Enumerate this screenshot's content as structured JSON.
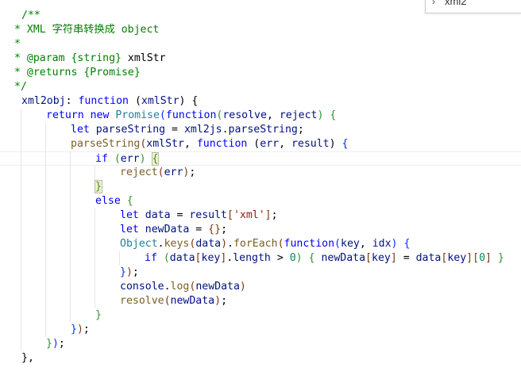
{
  "peek": {
    "label": "xml2",
    "icon": "chevron-right-icon"
  },
  "colors": {
    "comment": "#008000",
    "keyword": "#0000ff",
    "identifier": "#001080",
    "function": "#795e26",
    "type": "#267f99",
    "string": "#a31515",
    "number": "#098658",
    "bracket_level1": "#0431fa",
    "bracket_level2": "#319331",
    "bracket_level3": "#7b3814",
    "plain": "#000000",
    "indent_guide": "#e6e6e6",
    "bracket_match_bg": "#f2f2c6"
  },
  "code": {
    "current_line": 10,
    "lines": [
      {
        "indent": 1,
        "tokens": [
          {
            "t": "/**",
            "c": "comment"
          }
        ]
      },
      {
        "indent": 0,
        "tokens": [
          {
            "t": "* XML 字符串转换成 object",
            "c": "comment"
          }
        ]
      },
      {
        "indent": 0,
        "tokens": [
          {
            "t": "*",
            "c": "comment"
          }
        ]
      },
      {
        "indent": 0,
        "tokens": [
          {
            "t": "* @param {string} ",
            "c": "comment"
          },
          {
            "t": "xmlStr",
            "c": "plain"
          }
        ]
      },
      {
        "indent": 0,
        "tokens": [
          {
            "t": "* @returns {Promise}",
            "c": "comment"
          }
        ]
      },
      {
        "indent": 0,
        "tokens": [
          {
            "t": "*/",
            "c": "comment"
          }
        ]
      },
      {
        "indent": 1,
        "tokens": [
          {
            "t": "xml2obj",
            "c": "identifier"
          },
          {
            "t": ": ",
            "c": "plain"
          },
          {
            "t": "function",
            "c": "keyword"
          },
          {
            "t": " (",
            "c": "plain"
          },
          {
            "t": "xmlStr",
            "c": "identifier"
          },
          {
            "t": ") ",
            "c": "plain"
          },
          {
            "t": "{",
            "c": "plain"
          }
        ]
      },
      {
        "indent": 2,
        "tokens": [
          {
            "t": "return ",
            "c": "keyword"
          },
          {
            "t": "new ",
            "c": "keyword"
          },
          {
            "t": "Promise",
            "c": "type"
          },
          {
            "t": "(",
            "c": "bracket_level1"
          },
          {
            "t": "function",
            "c": "keyword"
          },
          {
            "t": "(",
            "c": "bracket_level2"
          },
          {
            "t": "resolve",
            "c": "identifier"
          },
          {
            "t": ", ",
            "c": "plain"
          },
          {
            "t": "reject",
            "c": "identifier"
          },
          {
            "t": ")",
            "c": "bracket_level2"
          },
          {
            "t": " ",
            "c": "plain"
          },
          {
            "t": "{",
            "c": "bracket_level2"
          }
        ]
      },
      {
        "indent": 3,
        "tokens": [
          {
            "t": "let ",
            "c": "keyword"
          },
          {
            "t": "parseString",
            "c": "identifier"
          },
          {
            "t": " = ",
            "c": "plain"
          },
          {
            "t": "xml2js",
            "c": "identifier"
          },
          {
            "t": ".",
            "c": "plain"
          },
          {
            "t": "parseString",
            "c": "identifier"
          },
          {
            "t": ";",
            "c": "plain"
          }
        ]
      },
      {
        "indent": 3,
        "tokens": [
          {
            "t": "parseString",
            "c": "function"
          },
          {
            "t": "(",
            "c": "bracket_level3"
          },
          {
            "t": "xmlStr",
            "c": "identifier"
          },
          {
            "t": ", ",
            "c": "plain"
          },
          {
            "t": "function",
            "c": "keyword"
          },
          {
            "t": " (",
            "c": "plain"
          },
          {
            "t": "err",
            "c": "identifier"
          },
          {
            "t": ", ",
            "c": "plain"
          },
          {
            "t": "result",
            "c": "identifier"
          },
          {
            "t": ") ",
            "c": "plain"
          },
          {
            "t": "{",
            "c": "bracket_level1"
          }
        ]
      },
      {
        "indent": 4,
        "tokens": [
          {
            "t": "if ",
            "c": "keyword"
          },
          {
            "t": "(",
            "c": "bracket_level2"
          },
          {
            "t": "err",
            "c": "identifier"
          },
          {
            "t": ")",
            "c": "bracket_level2"
          },
          {
            "t": " ",
            "c": "plain"
          },
          {
            "t": "{",
            "c": "bracket_level2",
            "match": true
          }
        ]
      },
      {
        "indent": 5,
        "tokens": [
          {
            "t": "reject",
            "c": "function"
          },
          {
            "t": "(",
            "c": "bracket_level3"
          },
          {
            "t": "err",
            "c": "identifier"
          },
          {
            "t": ")",
            "c": "bracket_level3"
          },
          {
            "t": ";",
            "c": "plain"
          }
        ]
      },
      {
        "indent": 4,
        "tokens": [
          {
            "t": "}",
            "c": "bracket_level2",
            "match": true
          }
        ]
      },
      {
        "indent": 4,
        "tokens": [
          {
            "t": "else ",
            "c": "keyword"
          },
          {
            "t": "{",
            "c": "bracket_level2"
          }
        ]
      },
      {
        "indent": 5,
        "tokens": [
          {
            "t": "let ",
            "c": "keyword"
          },
          {
            "t": "data",
            "c": "identifier"
          },
          {
            "t": " = ",
            "c": "plain"
          },
          {
            "t": "result",
            "c": "identifier"
          },
          {
            "t": "[",
            "c": "bracket_level3"
          },
          {
            "t": "'xml'",
            "c": "string"
          },
          {
            "t": "]",
            "c": "bracket_level3"
          },
          {
            "t": ";",
            "c": "plain"
          }
        ]
      },
      {
        "indent": 5,
        "tokens": [
          {
            "t": "let ",
            "c": "keyword"
          },
          {
            "t": "newData",
            "c": "identifier"
          },
          {
            "t": " = ",
            "c": "plain"
          },
          {
            "t": "{}",
            "c": "bracket_level3"
          },
          {
            "t": ";",
            "c": "plain"
          }
        ]
      },
      {
        "indent": 5,
        "tokens": [
          {
            "t": "Object",
            "c": "type"
          },
          {
            "t": ".",
            "c": "plain"
          },
          {
            "t": "keys",
            "c": "function"
          },
          {
            "t": "(",
            "c": "bracket_level3"
          },
          {
            "t": "data",
            "c": "identifier"
          },
          {
            "t": ")",
            "c": "bracket_level3"
          },
          {
            "t": ".",
            "c": "plain"
          },
          {
            "t": "forEach",
            "c": "function"
          },
          {
            "t": "(",
            "c": "bracket_level3"
          },
          {
            "t": "function",
            "c": "keyword"
          },
          {
            "t": "(",
            "c": "bracket_level1"
          },
          {
            "t": "key",
            "c": "identifier"
          },
          {
            "t": ", ",
            "c": "plain"
          },
          {
            "t": "idx",
            "c": "identifier"
          },
          {
            "t": ")",
            "c": "bracket_level1"
          },
          {
            "t": " ",
            "c": "plain"
          },
          {
            "t": "{",
            "c": "bracket_level1"
          }
        ]
      },
      {
        "indent": 6,
        "tokens": [
          {
            "t": "if ",
            "c": "keyword"
          },
          {
            "t": "(",
            "c": "bracket_level2"
          },
          {
            "t": "data",
            "c": "identifier"
          },
          {
            "t": "[",
            "c": "bracket_level3"
          },
          {
            "t": "key",
            "c": "identifier"
          },
          {
            "t": "]",
            "c": "bracket_level3"
          },
          {
            "t": ".",
            "c": "plain"
          },
          {
            "t": "length",
            "c": "identifier"
          },
          {
            "t": " > ",
            "c": "plain"
          },
          {
            "t": "0",
            "c": "number"
          },
          {
            "t": ")",
            "c": "bracket_level2"
          },
          {
            "t": " ",
            "c": "plain"
          },
          {
            "t": "{",
            "c": "bracket_level2"
          },
          {
            "t": " ",
            "c": "plain"
          },
          {
            "t": "newData",
            "c": "identifier"
          },
          {
            "t": "[",
            "c": "bracket_level3"
          },
          {
            "t": "key",
            "c": "identifier"
          },
          {
            "t": "]",
            "c": "bracket_level3"
          },
          {
            "t": " = ",
            "c": "plain"
          },
          {
            "t": "data",
            "c": "identifier"
          },
          {
            "t": "[",
            "c": "bracket_level3"
          },
          {
            "t": "key",
            "c": "identifier"
          },
          {
            "t": "]",
            "c": "bracket_level3"
          },
          {
            "t": "[",
            "c": "bracket_level3"
          },
          {
            "t": "0",
            "c": "number"
          },
          {
            "t": "]",
            "c": "bracket_level3"
          },
          {
            "t": " ",
            "c": "plain"
          },
          {
            "t": "}",
            "c": "bracket_level2"
          }
        ]
      },
      {
        "indent": 5,
        "tokens": [
          {
            "t": "}",
            "c": "bracket_level1"
          },
          {
            "t": ")",
            "c": "bracket_level3"
          },
          {
            "t": ";",
            "c": "plain"
          }
        ]
      },
      {
        "indent": 5,
        "tokens": [
          {
            "t": "console",
            "c": "identifier"
          },
          {
            "t": ".",
            "c": "plain"
          },
          {
            "t": "log",
            "c": "function"
          },
          {
            "t": "(",
            "c": "bracket_level3"
          },
          {
            "t": "newData",
            "c": "identifier"
          },
          {
            "t": ")",
            "c": "bracket_level3"
          }
        ]
      },
      {
        "indent": 5,
        "tokens": [
          {
            "t": "resolve",
            "c": "function"
          },
          {
            "t": "(",
            "c": "bracket_level3"
          },
          {
            "t": "newData",
            "c": "identifier"
          },
          {
            "t": ")",
            "c": "bracket_level3"
          },
          {
            "t": ";",
            "c": "plain"
          }
        ]
      },
      {
        "indent": 4,
        "tokens": [
          {
            "t": "}",
            "c": "bracket_level2"
          }
        ]
      },
      {
        "indent": 3,
        "tokens": [
          {
            "t": "}",
            "c": "bracket_level1"
          },
          {
            "t": ")",
            "c": "bracket_level3"
          },
          {
            "t": ";",
            "c": "plain"
          }
        ]
      },
      {
        "indent": 2,
        "tokens": [
          {
            "t": "}",
            "c": "bracket_level2"
          },
          {
            "t": ")",
            "c": "bracket_level1"
          },
          {
            "t": ";",
            "c": "plain"
          }
        ]
      },
      {
        "indent": 1,
        "tokens": [
          {
            "t": "}",
            "c": "plain"
          },
          {
            "t": ",",
            "c": "plain"
          }
        ]
      }
    ]
  }
}
